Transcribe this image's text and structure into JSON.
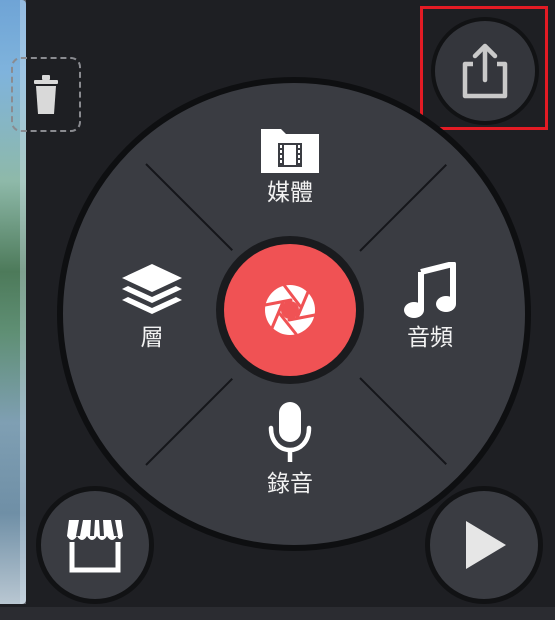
{
  "menu": {
    "media": {
      "label": "媒體",
      "icon": "film-folder-icon"
    },
    "layer": {
      "label": "層",
      "icon": "layers-icon"
    },
    "audio": {
      "label": "音頻",
      "icon": "music-note-icon"
    },
    "record": {
      "label": "錄音",
      "icon": "microphone-icon"
    },
    "capture": {
      "icon": "camera-shutter-icon"
    }
  },
  "toolbar": {
    "share": {
      "icon": "share-upload-icon"
    },
    "delete": {
      "icon": "trash-icon"
    },
    "store": {
      "icon": "store-awning-icon"
    },
    "play": {
      "icon": "play-icon"
    }
  },
  "colors": {
    "accent": "#f05254",
    "highlight": "#e31b24",
    "wheel": "#3a3c42",
    "background": "#1e1f23"
  }
}
